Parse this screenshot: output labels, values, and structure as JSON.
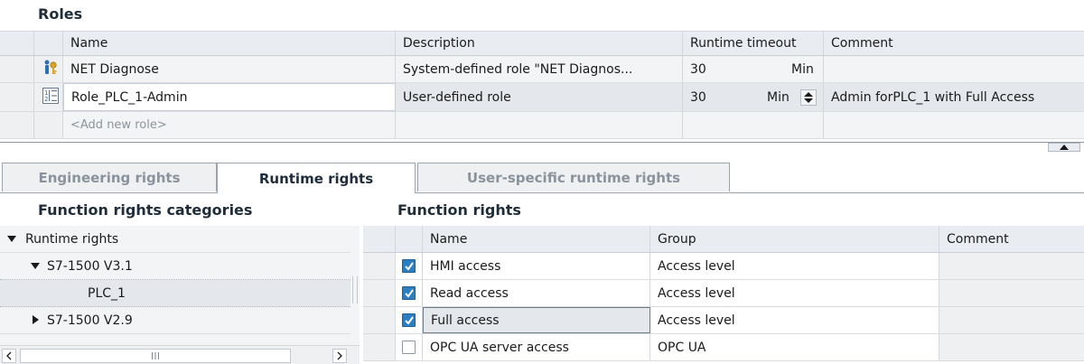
{
  "roles": {
    "title": "Roles",
    "columns": {
      "name": "Name",
      "description": "Description",
      "runtime_timeout": "Runtime timeout",
      "comment": "Comment"
    },
    "rows": [
      {
        "icon": "system-role-icon",
        "name": "NET Diagnose",
        "description": "System-defined role \"NET Diagnos...",
        "timeout": "30",
        "unit": "Min",
        "comment": ""
      },
      {
        "icon": "user-role-icon",
        "name": "Role_PLC_1-Admin",
        "description": "User-defined role",
        "timeout": "30",
        "unit": "Min",
        "comment": "Admin forPLC_1 with Full Access"
      }
    ],
    "add_new": "<Add new role>"
  },
  "tabs": [
    "Engineering rights",
    "Runtime rights",
    "User-specific runtime rights"
  ],
  "active_tab": "Runtime rights",
  "categories": {
    "title": "Function rights categories",
    "items": [
      {
        "label": "Runtime rights",
        "expanded": true
      },
      {
        "label": "S7-1500 V3.1",
        "expanded": true
      },
      {
        "label": "PLC_1",
        "selected": true
      },
      {
        "label": "S7-1500 V2.9",
        "expanded": false
      }
    ]
  },
  "function_rights": {
    "title": "Function rights",
    "columns": {
      "name": "Name",
      "group": "Group",
      "comment": "Comment"
    },
    "rows": [
      {
        "checked": true,
        "name": "HMI access",
        "group": "Access level",
        "comment": ""
      },
      {
        "checked": true,
        "name": "Read access",
        "group": "Access level",
        "comment": ""
      },
      {
        "checked": true,
        "name": "Full access",
        "group": "Access level",
        "comment": ""
      },
      {
        "checked": false,
        "name": "OPC UA server access",
        "group": "OPC UA",
        "comment": ""
      }
    ]
  },
  "colors": {
    "accent": "#2e7fc1",
    "header_bg": "#e9edf1",
    "selection": "#e4e8ec"
  }
}
